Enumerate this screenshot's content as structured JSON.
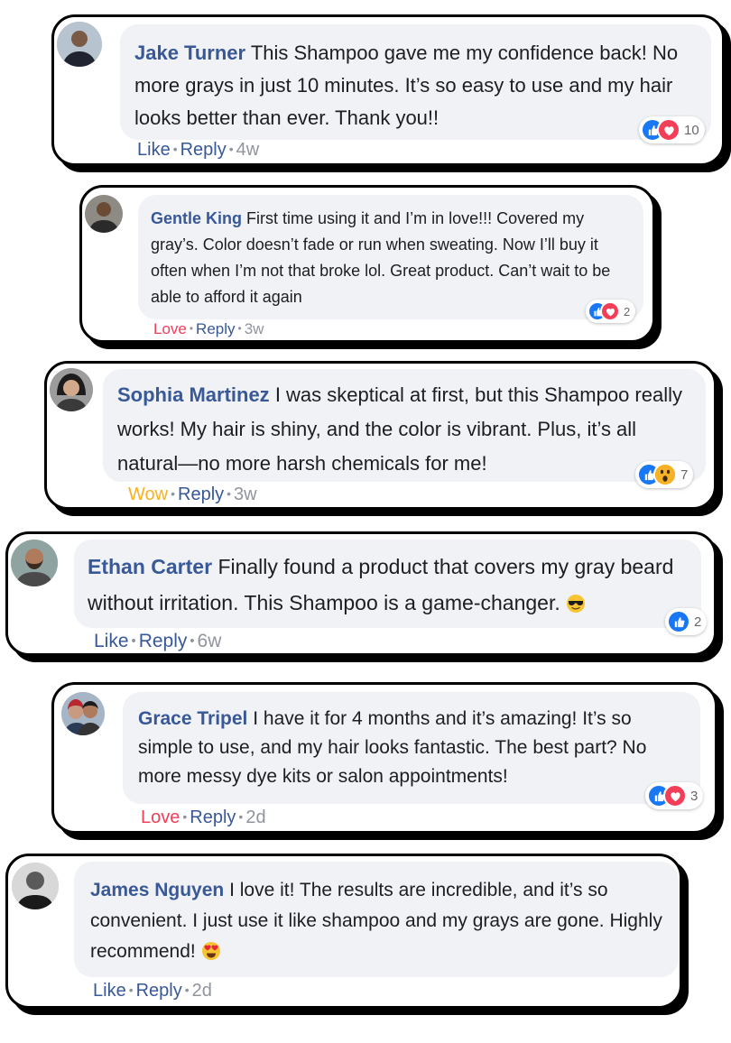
{
  "comments": [
    {
      "name": "Jake Turner",
      "text": "This Shampoo gave me my confidence back! No more grays in just 10 minutes. It’s so easy to use and my hair looks better than ever. Thank you!!",
      "action": "Like",
      "reply": "Reply",
      "time": "4w",
      "count": "10",
      "reactions": [
        "like",
        "love"
      ]
    },
    {
      "name": "Gentle King",
      "text": "First time using it and I’m in love!!! Covered my gray’s. Color doesn’t fade or run when sweating. Now I’ll buy it often when I’m not that broke lol. Great product. Can’t wait to be able to afford it again",
      "action": "Love",
      "reply": "Reply",
      "time": "3w",
      "count": "2",
      "reactions": [
        "like",
        "love"
      ]
    },
    {
      "name": "Sophia Martinez",
      "text": "I was skeptical at first, but  this Shampoo really works! My hair is shiny, and the color is vibrant. Plus, it’s all natural—no more harsh chemicals for me!",
      "action": "Wow",
      "reply": "Reply",
      "time": "3w",
      "count": "7",
      "reactions": [
        "like",
        "wow"
      ]
    },
    {
      "name": "Ethan Carter",
      "text": "Finally found a product that covers my gray beard without irritation. This Shampoo is a game-changer.",
      "emoji": "sunglasses-emoji",
      "action": "Like",
      "reply": "Reply",
      "time": "6w",
      "count": "2",
      "reactions": [
        "like"
      ]
    },
    {
      "name": "Grace Tripel",
      "text": "I have it for 4 months and it’s amazing! It’s so simple to use, and my hair looks fantastic. The best part? No more messy dye kits or salon appointments!",
      "action": "Love",
      "reply": "Reply",
      "time": "2d",
      "count": "3",
      "reactions": [
        "like",
        "love"
      ]
    },
    {
      "name": "James Nguyen",
      "text": "I love it! The results are incredible, and it’s so convenient. I just use it like shampoo and my grays are gone. Highly recommend!",
      "emoji": "heart-eyes-emoji",
      "action": "Like",
      "reply": "Reply",
      "time": "2d",
      "count": "",
      "reactions": []
    }
  ],
  "colors": {
    "name": "#385898",
    "like": "#1877f2",
    "love": "#f33e58",
    "wow": "#f7b125",
    "bubble": "#f0f2f5",
    "muted": "#90949c"
  }
}
